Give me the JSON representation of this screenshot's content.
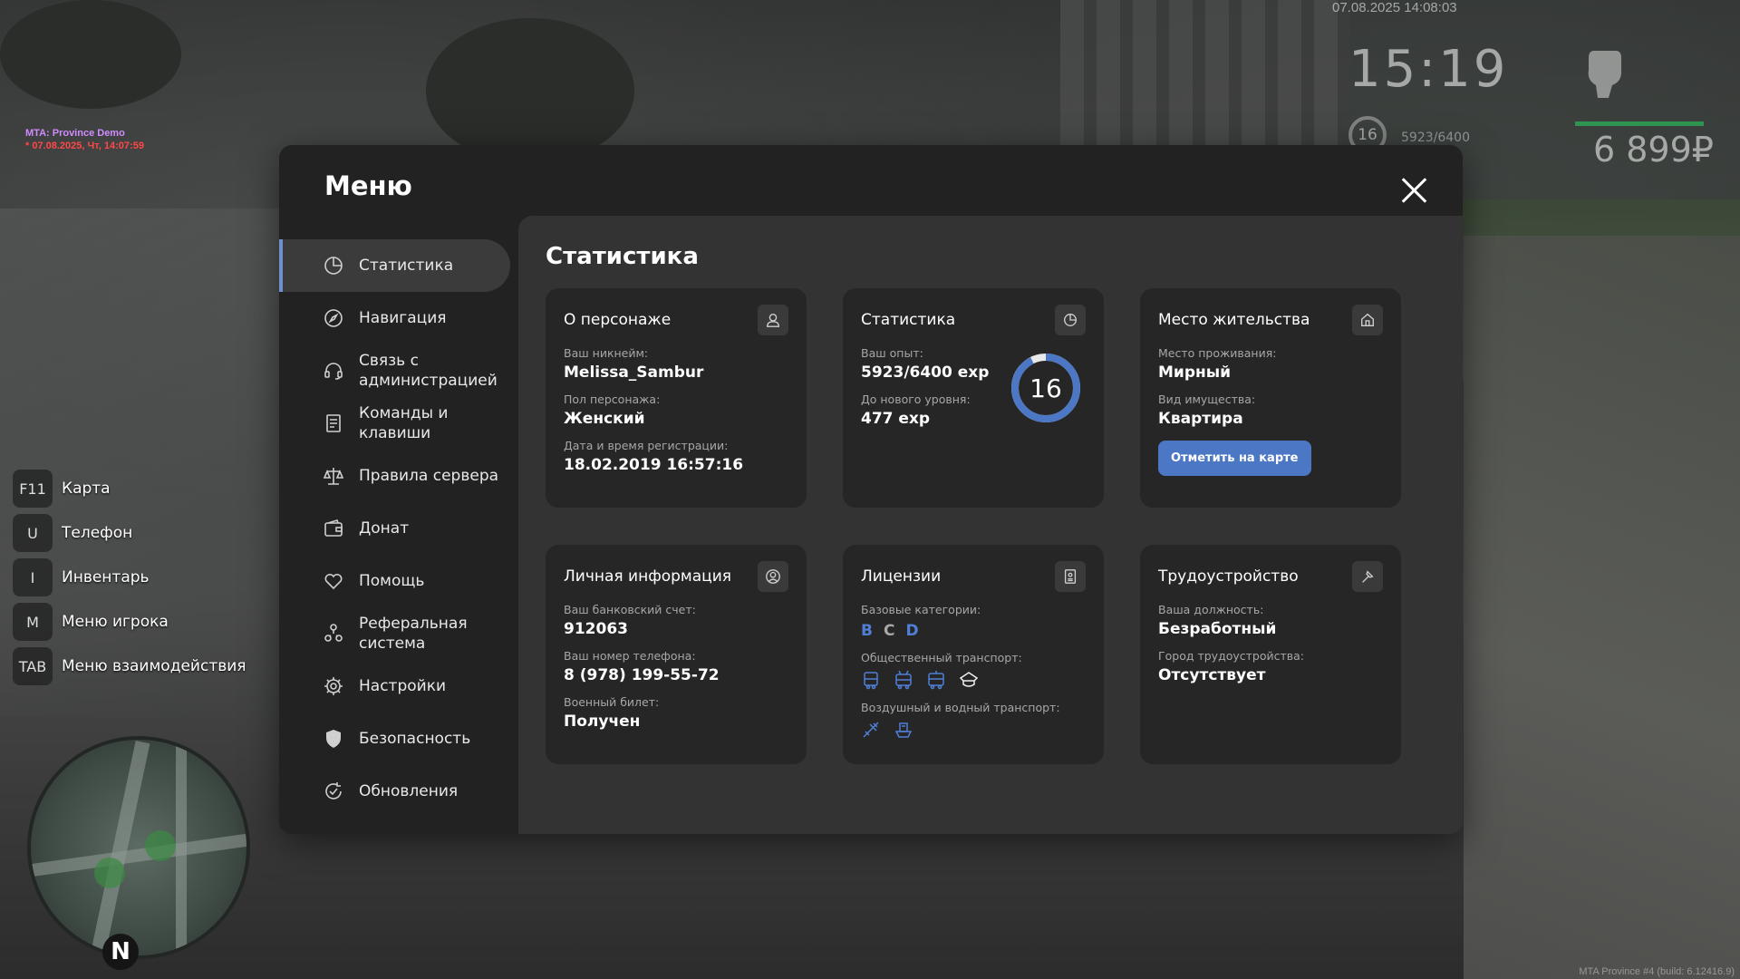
{
  "debug": {
    "server": "MTA: Province Demo",
    "datetime": "* 07.08.2025, Чт, 14:07:59"
  },
  "hud": {
    "date": "07.08.2025 14:08:03",
    "time": "15:19",
    "level": "16",
    "exp": "5923/6400",
    "money": "6 899₽"
  },
  "hotkeys": [
    {
      "key": "F11",
      "label": "Карта"
    },
    {
      "key": "U",
      "label": "Телефон"
    },
    {
      "key": "I",
      "label": "Инвентарь"
    },
    {
      "key": "M",
      "label": "Меню игрока"
    },
    {
      "key": "TAB",
      "label": "Меню взаимодействия"
    }
  ],
  "minimap": {
    "north": "N"
  },
  "build": "MTA Province #4 (build: 6.12416.9)",
  "menu": {
    "title": "Меню",
    "sidebar": [
      {
        "label": "Статистика",
        "icon": "pie-chart-icon",
        "active": true
      },
      {
        "label": "Навигация",
        "icon": "compass-icon"
      },
      {
        "label": "Связь с администрацией",
        "icon": "headset-icon"
      },
      {
        "label": "Команды и клавиши",
        "icon": "document-icon"
      },
      {
        "label": "Правила сервера",
        "icon": "scales-icon"
      },
      {
        "label": "Донат",
        "icon": "wallet-icon"
      },
      {
        "label": "Помощь",
        "icon": "heart-hands-icon"
      },
      {
        "label": "Реферальная система",
        "icon": "people-icon"
      },
      {
        "label": "Настройки",
        "icon": "gear-icon"
      },
      {
        "label": "Безопасность",
        "icon": "shield-icon"
      },
      {
        "label": "Обновления",
        "icon": "refresh-check-icon"
      }
    ],
    "content_title": "Статистика",
    "cards": {
      "character": {
        "title": "О персонаже",
        "nick_label": "Ваш никнейм:",
        "nick": "Melissa_Sambur",
        "gender_label": "Пол персонажа:",
        "gender": "Женский",
        "reg_label": "Дата и время регистрации:",
        "reg": "18.02.2019 16:57:16"
      },
      "stats": {
        "title": "Статистика",
        "exp_label": "Ваш опыт:",
        "exp": "5923/6400 exp",
        "next_label": "До нового уровня:",
        "next": "477 exp",
        "level": "16",
        "progress": 0.925
      },
      "residence": {
        "title": "Место жительства",
        "place_label": "Место проживания:",
        "place": "Мирный",
        "type_label": "Вид имущества:",
        "type": "Квартира",
        "button": "Отметить на карте"
      },
      "personal": {
        "title": "Личная информация",
        "bank_label": "Ваш банковский счет:",
        "bank": "912063",
        "phone_label": "Ваш номер телефона:",
        "phone": "8 (978) 199-55-72",
        "military_label": "Военный билет:",
        "military": "Получен"
      },
      "licenses": {
        "title": "Лицензии",
        "base_label": "Базовые категории:",
        "base": [
          {
            "cat": "B",
            "owned": true
          },
          {
            "cat": "C",
            "owned": false
          },
          {
            "cat": "D",
            "owned": true
          }
        ],
        "public_label": "Общественный транспорт:",
        "public_icons": [
          "bus-icon",
          "trolleybus-icon",
          "tram-icon",
          "police-cap-icon"
        ],
        "air_label": "Воздушный и водный транспорт:",
        "air_icons": [
          "plane-icon",
          "boat-icon"
        ]
      },
      "job": {
        "title": "Трудоустройство",
        "position_label": "Ваша должность:",
        "position": "Безработный",
        "city_label": "Город трудоустройства:",
        "city": "Отсутствует"
      }
    }
  },
  "colors": {
    "accent": "#4b77c4",
    "license_blue": "#4f7fd6",
    "panel": "#222222",
    "content_bg": "#333333",
    "card_bg": "#262626"
  }
}
